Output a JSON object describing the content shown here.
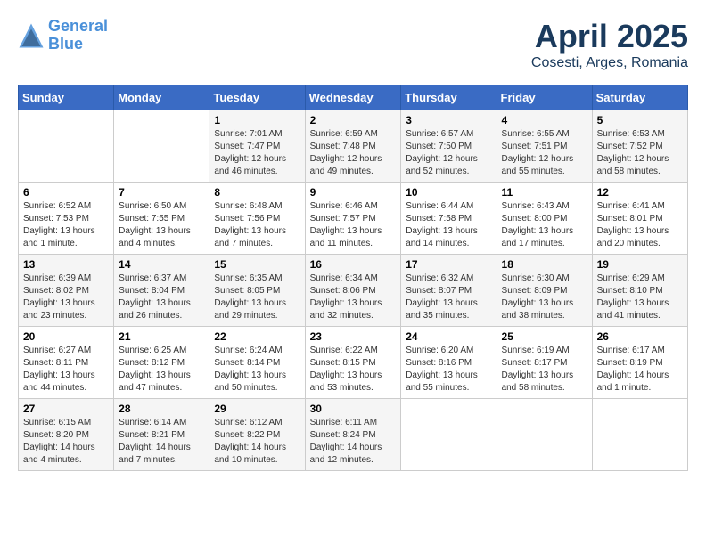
{
  "header": {
    "logo_line1": "General",
    "logo_line2": "Blue",
    "month": "April 2025",
    "location": "Cosesti, Arges, Romania"
  },
  "weekdays": [
    "Sunday",
    "Monday",
    "Tuesday",
    "Wednesday",
    "Thursday",
    "Friday",
    "Saturday"
  ],
  "weeks": [
    [
      {
        "day": "",
        "info": ""
      },
      {
        "day": "",
        "info": ""
      },
      {
        "day": "1",
        "info": "Sunrise: 7:01 AM\nSunset: 7:47 PM\nDaylight: 12 hours and 46 minutes."
      },
      {
        "day": "2",
        "info": "Sunrise: 6:59 AM\nSunset: 7:48 PM\nDaylight: 12 hours and 49 minutes."
      },
      {
        "day": "3",
        "info": "Sunrise: 6:57 AM\nSunset: 7:50 PM\nDaylight: 12 hours and 52 minutes."
      },
      {
        "day": "4",
        "info": "Sunrise: 6:55 AM\nSunset: 7:51 PM\nDaylight: 12 hours and 55 minutes."
      },
      {
        "day": "5",
        "info": "Sunrise: 6:53 AM\nSunset: 7:52 PM\nDaylight: 12 hours and 58 minutes."
      }
    ],
    [
      {
        "day": "6",
        "info": "Sunrise: 6:52 AM\nSunset: 7:53 PM\nDaylight: 13 hours and 1 minute."
      },
      {
        "day": "7",
        "info": "Sunrise: 6:50 AM\nSunset: 7:55 PM\nDaylight: 13 hours and 4 minutes."
      },
      {
        "day": "8",
        "info": "Sunrise: 6:48 AM\nSunset: 7:56 PM\nDaylight: 13 hours and 7 minutes."
      },
      {
        "day": "9",
        "info": "Sunrise: 6:46 AM\nSunset: 7:57 PM\nDaylight: 13 hours and 11 minutes."
      },
      {
        "day": "10",
        "info": "Sunrise: 6:44 AM\nSunset: 7:58 PM\nDaylight: 13 hours and 14 minutes."
      },
      {
        "day": "11",
        "info": "Sunrise: 6:43 AM\nSunset: 8:00 PM\nDaylight: 13 hours and 17 minutes."
      },
      {
        "day": "12",
        "info": "Sunrise: 6:41 AM\nSunset: 8:01 PM\nDaylight: 13 hours and 20 minutes."
      }
    ],
    [
      {
        "day": "13",
        "info": "Sunrise: 6:39 AM\nSunset: 8:02 PM\nDaylight: 13 hours and 23 minutes."
      },
      {
        "day": "14",
        "info": "Sunrise: 6:37 AM\nSunset: 8:04 PM\nDaylight: 13 hours and 26 minutes."
      },
      {
        "day": "15",
        "info": "Sunrise: 6:35 AM\nSunset: 8:05 PM\nDaylight: 13 hours and 29 minutes."
      },
      {
        "day": "16",
        "info": "Sunrise: 6:34 AM\nSunset: 8:06 PM\nDaylight: 13 hours and 32 minutes."
      },
      {
        "day": "17",
        "info": "Sunrise: 6:32 AM\nSunset: 8:07 PM\nDaylight: 13 hours and 35 minutes."
      },
      {
        "day": "18",
        "info": "Sunrise: 6:30 AM\nSunset: 8:09 PM\nDaylight: 13 hours and 38 minutes."
      },
      {
        "day": "19",
        "info": "Sunrise: 6:29 AM\nSunset: 8:10 PM\nDaylight: 13 hours and 41 minutes."
      }
    ],
    [
      {
        "day": "20",
        "info": "Sunrise: 6:27 AM\nSunset: 8:11 PM\nDaylight: 13 hours and 44 minutes."
      },
      {
        "day": "21",
        "info": "Sunrise: 6:25 AM\nSunset: 8:12 PM\nDaylight: 13 hours and 47 minutes."
      },
      {
        "day": "22",
        "info": "Sunrise: 6:24 AM\nSunset: 8:14 PM\nDaylight: 13 hours and 50 minutes."
      },
      {
        "day": "23",
        "info": "Sunrise: 6:22 AM\nSunset: 8:15 PM\nDaylight: 13 hours and 53 minutes."
      },
      {
        "day": "24",
        "info": "Sunrise: 6:20 AM\nSunset: 8:16 PM\nDaylight: 13 hours and 55 minutes."
      },
      {
        "day": "25",
        "info": "Sunrise: 6:19 AM\nSunset: 8:17 PM\nDaylight: 13 hours and 58 minutes."
      },
      {
        "day": "26",
        "info": "Sunrise: 6:17 AM\nSunset: 8:19 PM\nDaylight: 14 hours and 1 minute."
      }
    ],
    [
      {
        "day": "27",
        "info": "Sunrise: 6:15 AM\nSunset: 8:20 PM\nDaylight: 14 hours and 4 minutes."
      },
      {
        "day": "28",
        "info": "Sunrise: 6:14 AM\nSunset: 8:21 PM\nDaylight: 14 hours and 7 minutes."
      },
      {
        "day": "29",
        "info": "Sunrise: 6:12 AM\nSunset: 8:22 PM\nDaylight: 14 hours and 10 minutes."
      },
      {
        "day": "30",
        "info": "Sunrise: 6:11 AM\nSunset: 8:24 PM\nDaylight: 14 hours and 12 minutes."
      },
      {
        "day": "",
        "info": ""
      },
      {
        "day": "",
        "info": ""
      },
      {
        "day": "",
        "info": ""
      }
    ]
  ]
}
